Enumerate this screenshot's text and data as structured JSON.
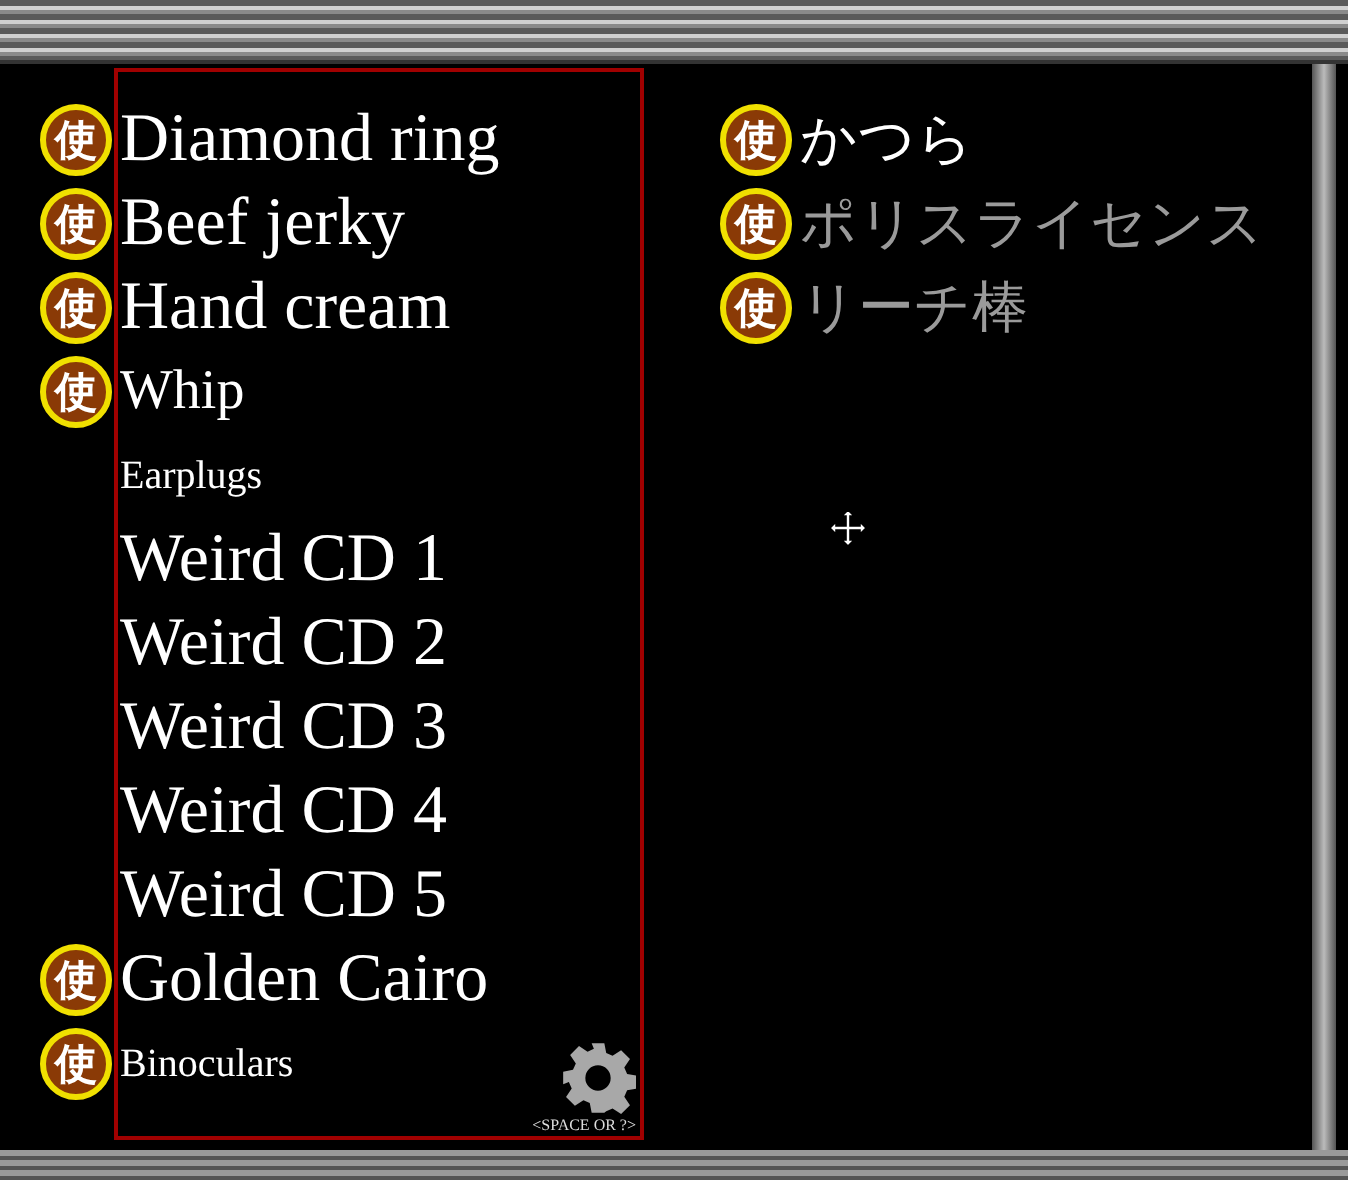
{
  "left_items": [
    {
      "label": "Diamond ring",
      "badge": "使",
      "kind": "large"
    },
    {
      "label": "Beef jerky",
      "badge": "使",
      "kind": "large"
    },
    {
      "label": "Hand cream",
      "badge": "使",
      "kind": "large"
    },
    {
      "label": "Whip",
      "badge": "使",
      "kind": "medium"
    },
    {
      "label": "Earplugs",
      "kind": "small"
    },
    {
      "label": "Weird CD 1",
      "kind": "large"
    },
    {
      "label": "Weird CD 2",
      "kind": "large"
    },
    {
      "label": "Weird CD 3",
      "kind": "large"
    },
    {
      "label": "Weird CD 4",
      "kind": "large"
    },
    {
      "label": "Weird CD 5",
      "kind": "large"
    },
    {
      "label": "Golden Cairo",
      "badge": "使",
      "kind": "large"
    },
    {
      "label": "Binoculars",
      "badge": "使",
      "kind": "small"
    }
  ],
  "right_items": [
    {
      "label": "かつら",
      "badge": "使",
      "disabled": false
    },
    {
      "label": "ポリスライセンス",
      "badge": "使",
      "disabled": true
    },
    {
      "label": "リーチ棒",
      "badge": "使",
      "disabled": true
    }
  ],
  "overlay_hint": "<SPACE OR ?>"
}
